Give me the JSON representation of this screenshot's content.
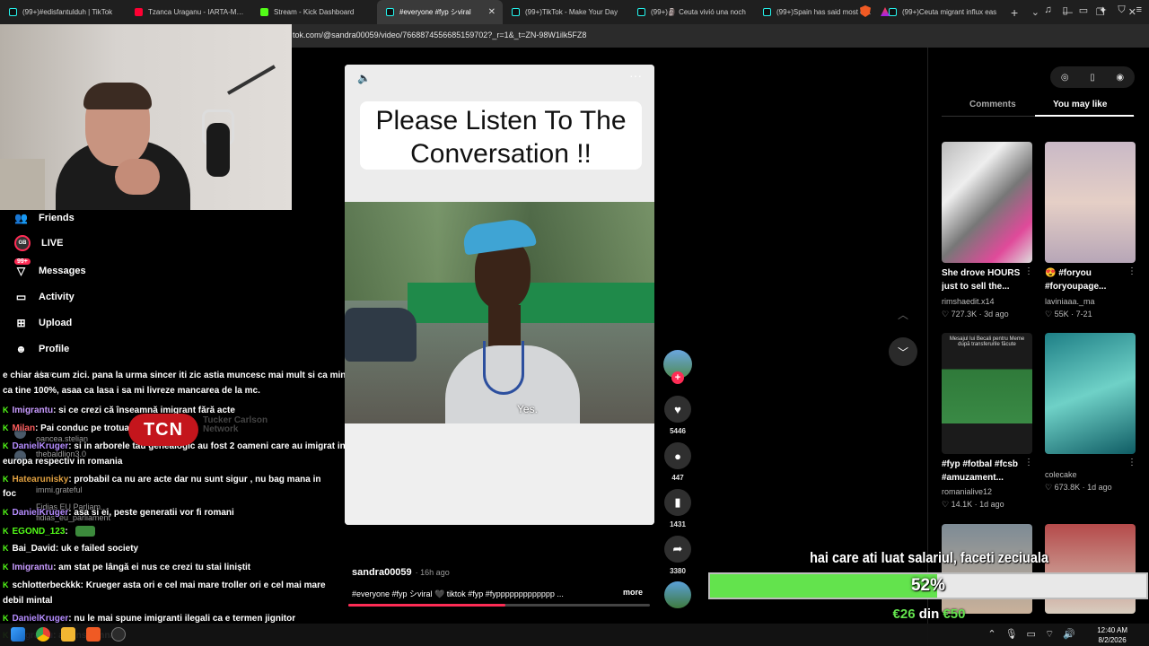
{
  "browser": {
    "tabs": [
      {
        "title": "(99+)#edisfantulduh | TikTok",
        "icon": "tiktok-icon",
        "active": false
      },
      {
        "title": "Tzanca Uraganu - IARTA-MA M",
        "icon": "youtube-icon",
        "active": false
      },
      {
        "title": "Stream - Kick Dashboard",
        "icon": "kick-icon",
        "active": false
      },
      {
        "title": "#everyone #fyp シviral",
        "icon": "tiktok-icon",
        "active": true
      },
      {
        "title": "(99+)TikTok - Make Your Day",
        "icon": "tiktok-icon",
        "active": false
      },
      {
        "title": "(99+)🗿 Ceuta vivió una noch",
        "icon": "tiktok-icon",
        "active": false
      },
      {
        "title": "(99+)Spain has said most of th",
        "icon": "tiktok-icon",
        "active": false
      },
      {
        "title": "(99+)Ceuta migrant influx eas",
        "icon": "tiktok-icon",
        "active": false
      }
    ],
    "new_tab_label": "+",
    "close_tab_glyph": "✕",
    "url": "tok.com/@sandra00059/video/7668874556685159702?_r=1&_t=ZN-98W1ilk5FZ8"
  },
  "sidebar": {
    "items": [
      {
        "label": "Friends",
        "icon": "friends-icon"
      },
      {
        "label": "LIVE",
        "icon": "live-icon"
      },
      {
        "label": "Messages",
        "icon": "messages-icon",
        "badge": "99+"
      },
      {
        "label": "Activity",
        "icon": "activity-icon"
      },
      {
        "label": "Upload",
        "icon": "upload-icon"
      },
      {
        "label": "Profile",
        "icon": "profile-icon"
      }
    ],
    "live_badge_text": "GB"
  },
  "chat": {
    "messages": [
      {
        "user": "",
        "text": "e chiar asa cum zici. pana la urma sincer iti zic astia muncesc mai mult si ca mine si"
      },
      {
        "user": "",
        "text": "ca tine 100%, asaa ca lasa i sa mi livreze mancarea de la mc."
      },
      {
        "user": "Imigrantu",
        "text": ": si ce crezi că înseamnă imigrant fără acte"
      },
      {
        "user": "Milan",
        "text": ": Pai conduc pe trotuare"
      },
      {
        "user": "DanielKruger",
        "text": ": si in arborele tau genealogic au fost 2 oameni care au imigrat in"
      },
      {
        "user": "",
        "text": "europa respectiv in romania"
      },
      {
        "user": "Hatearunisky",
        "text": ": probabil ca nu are acte dar nu sunt sigur , nu bag mana in"
      },
      {
        "user": "",
        "text": "foc"
      },
      {
        "user": "DanielKruger",
        "text": ": asa si ei, peste generatii vor fi romani"
      },
      {
        "user": "EGOND_123",
        "text": ":"
      },
      {
        "user": "Bai_David",
        "text": ": uk e failed society"
      },
      {
        "user": "Imigrantu",
        "text": ": am stat pe lângă ei nus ce crezi tu stai liniștit"
      },
      {
        "user": "schlotterbeckkk",
        "text": ": Krueger asta ori e cel mai mare troller ori e cel mai mare"
      },
      {
        "user": "",
        "text": "debil mintal"
      },
      {
        "user": "DanielKruger",
        "text": ": nu le mai spune imigranti ilegali ca e termen jignitor"
      },
      {
        "user": "Imigrantu",
        "text": ": ala inseamna"
      }
    ],
    "ghost_names": [
      "oancea.stelian",
      "thebaldlion3.0",
      "immi.grateful",
      "Fidias EU Parliam...",
      "fidias_eu_parliament",
      "More"
    ]
  },
  "video": {
    "caption_text": "Please Listen To The Conversation  !!",
    "subtitle": "Yes.",
    "logo_text": "TCN",
    "logo_subtext": "Tucker Carlson Network",
    "more_glyph": "···",
    "mute_glyph": "🔈",
    "username": "sandra00059",
    "time_ago": "· 16h ago",
    "description": "#everyone #fyp シviral 🖤 tiktok #fyp #fyppppppppppppp ...",
    "more_label": "more",
    "progress": 0.52
  },
  "actions": {
    "likes": "5446",
    "comments": "447",
    "saves": "1431",
    "shares": "3380",
    "follow_glyph": "+"
  },
  "right_panel": {
    "tabs": [
      "Comments",
      "You may like"
    ],
    "top_icons": [
      "compass-icon",
      "phone-icon",
      "avatar-icon"
    ],
    "items": [
      {
        "title": "She drove HOURS just to sell the...",
        "author": "rimshaedit.x14",
        "likes": "727.3K",
        "date": "3d ago"
      },
      {
        "title": "😍 #foryou #foryoupage...",
        "author": "laviniaaa._ma",
        "likes": "55K",
        "date": "7-21"
      },
      {
        "title": "#fyp #fotbal #fcsb #amuzament...",
        "author": "romanialive12",
        "likes": "14.1K",
        "date": "1d ago"
      },
      {
        "title": "",
        "author": "colecake",
        "likes": "673.8K",
        "date": "1d ago"
      }
    ],
    "thumb_texts": [
      "Mesajul lui Becali pentru Meme după transferurile făcute"
    ]
  },
  "donation": {
    "title": "hai care ati luat salariul, faceti zeciuala",
    "percent": 52,
    "percent_label": "52%",
    "current": "€26",
    "sep": "din",
    "goal": "€50"
  },
  "taskbar": {
    "time": "12:40 AM",
    "date": "8/2/2026"
  }
}
